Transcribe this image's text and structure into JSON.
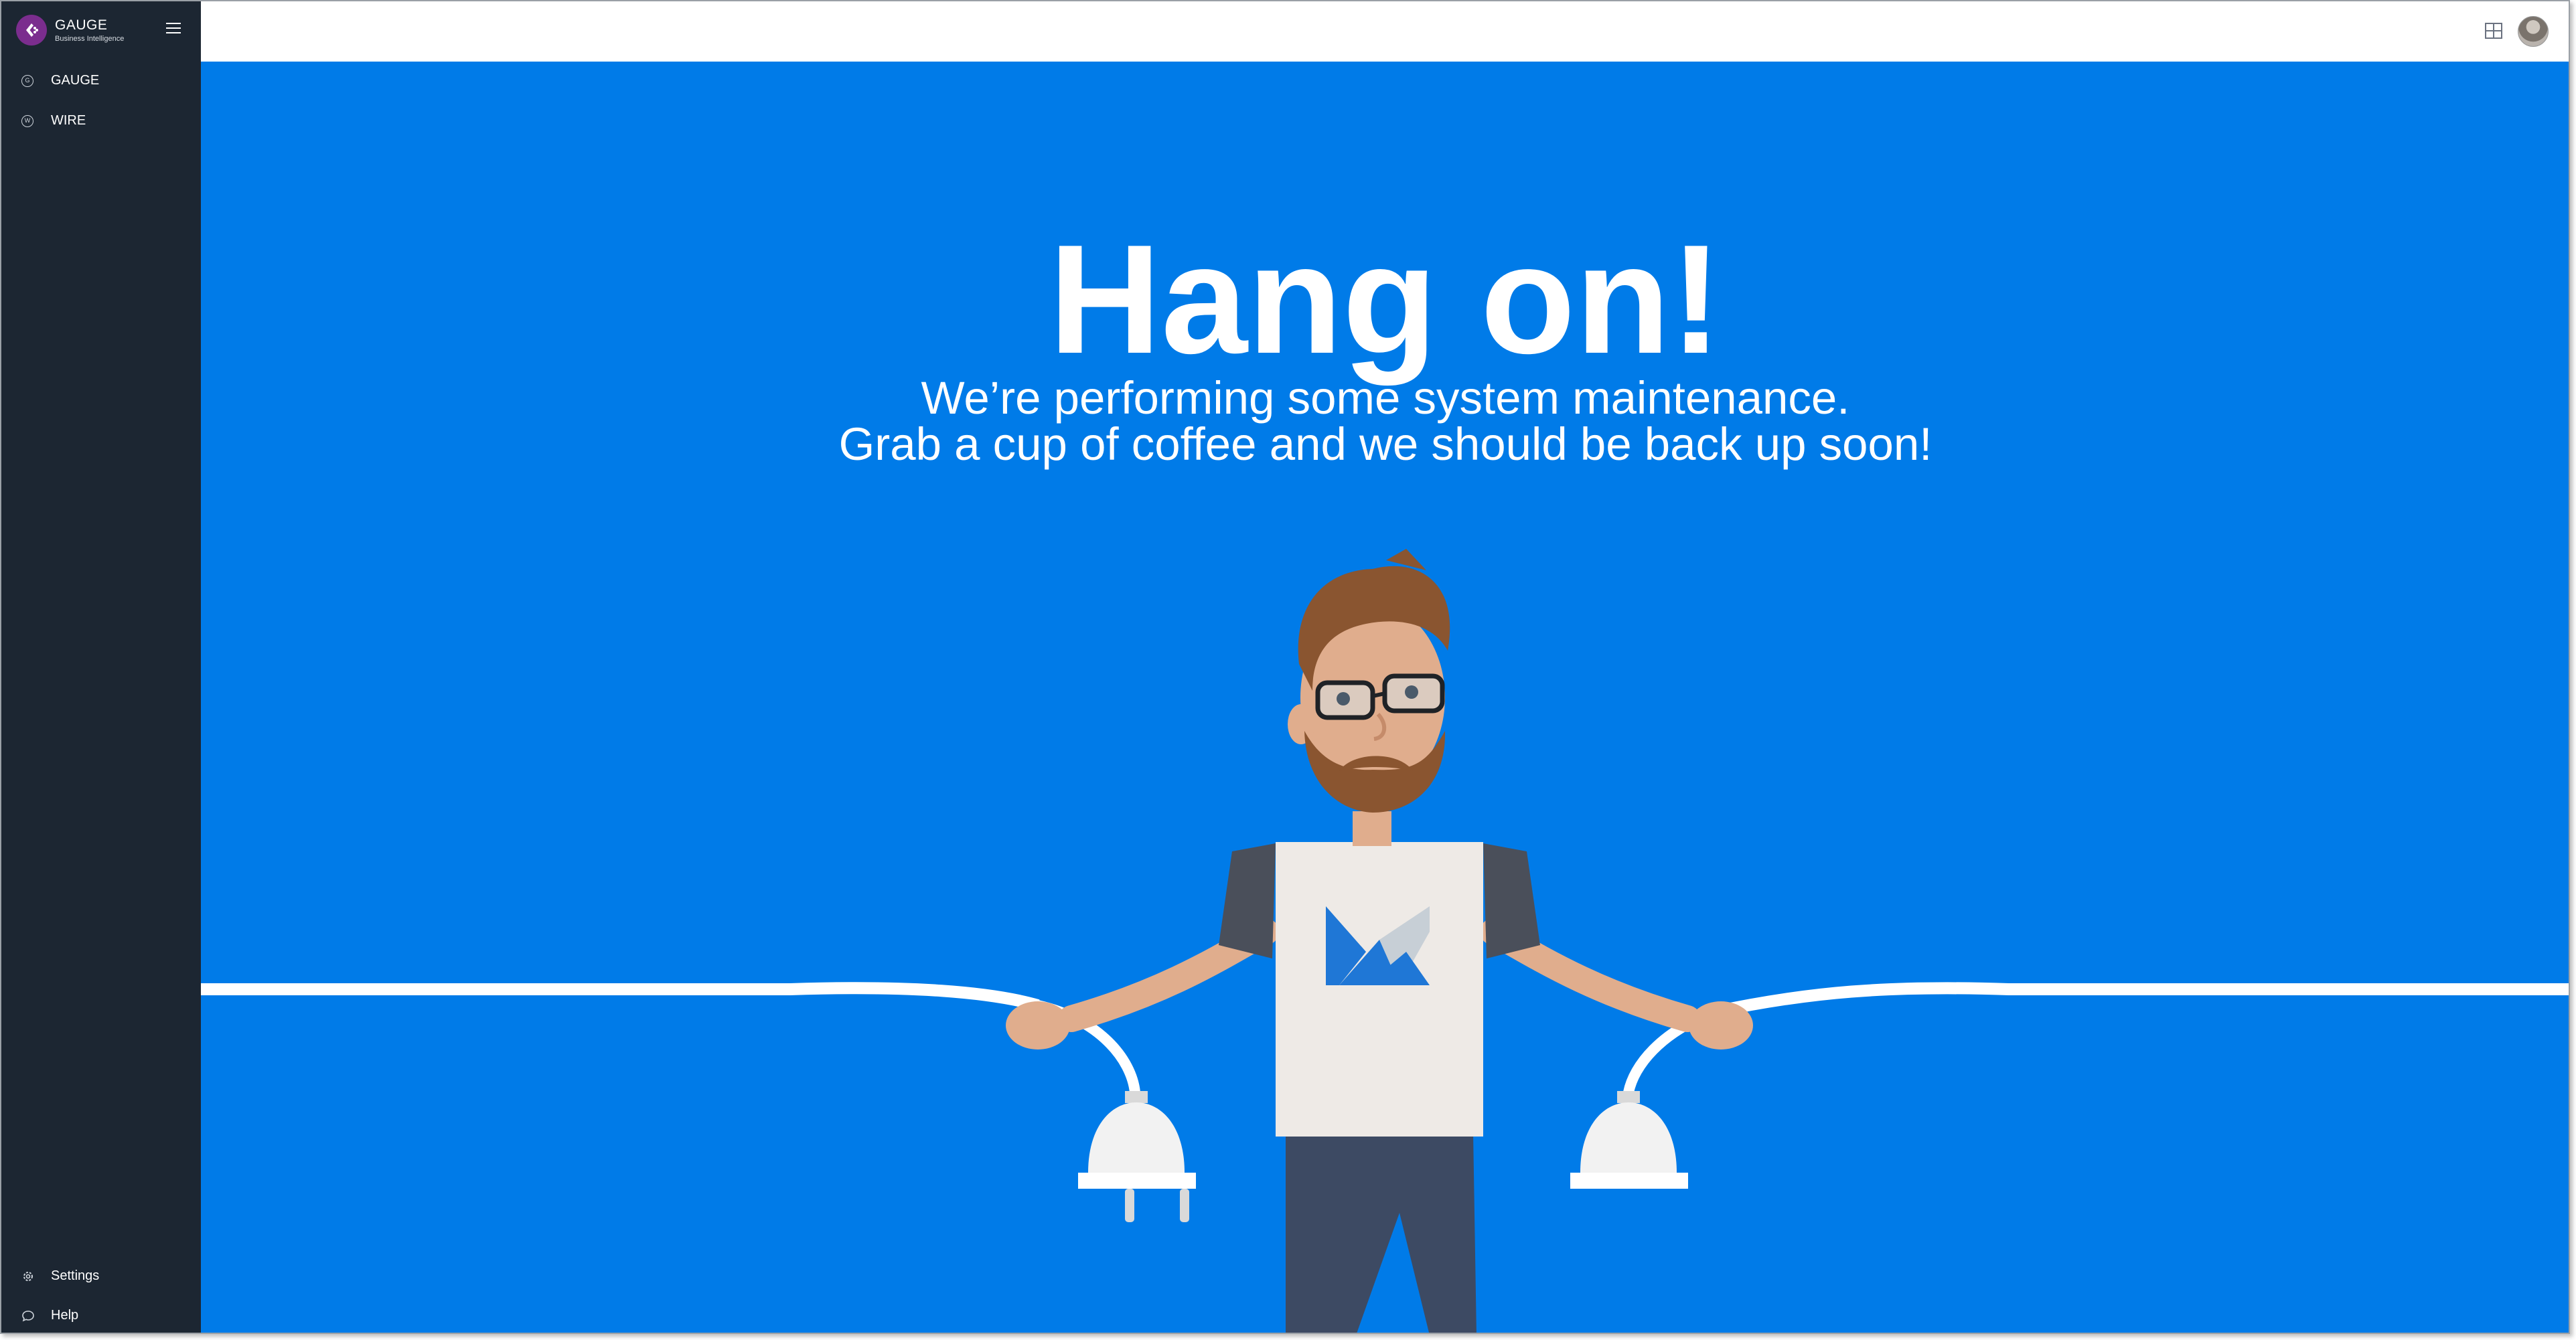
{
  "sidebar": {
    "brand": {
      "name": "GAUGE",
      "subtitle": "Business Intelligence",
      "logo_color": "#7b2d8e"
    },
    "nav_items": [
      {
        "label": "GAUGE",
        "icon": "gauge-icon"
      },
      {
        "label": "WIRE",
        "icon": "wire-icon"
      }
    ],
    "bottom_items": [
      {
        "label": "Settings",
        "icon": "gear-icon"
      },
      {
        "label": "Help",
        "icon": "chat-bubble-icon"
      }
    ],
    "background": "#1c2632"
  },
  "topbar": {
    "icons": [
      "grid-icon",
      "avatar"
    ]
  },
  "main": {
    "background": "#007be8",
    "headline": "Hang on!",
    "message_line1": "We’re performing some system maintenance.",
    "message_line2": "Grab a cup of coffee and we should be back up soon!"
  }
}
